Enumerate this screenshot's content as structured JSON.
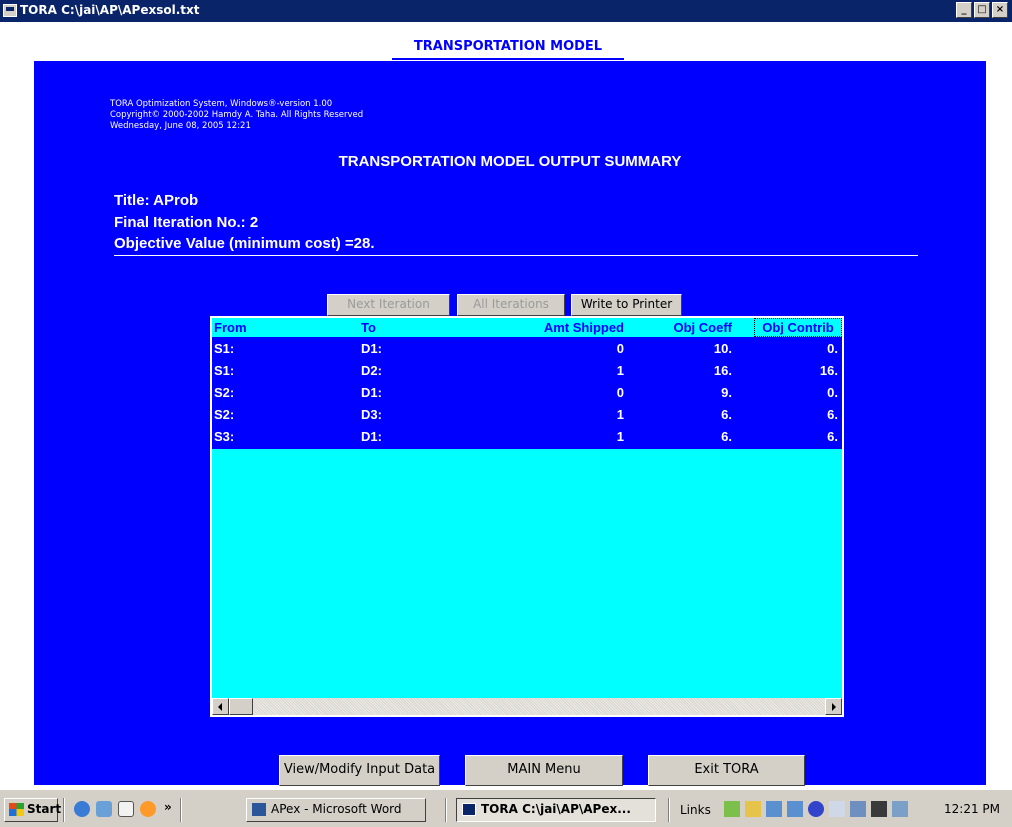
{
  "window": {
    "title": "TORA  C:\\jai\\AP\\APexsol.txt",
    "controls": [
      "_",
      "□",
      "×"
    ]
  },
  "header": {
    "model_title": "TRANSPORTATION MODEL"
  },
  "panel": {
    "copyright_lines": [
      "TORA Optimization System, Windows®-version 1.00",
      "Copyright© 2000-2002 Hamdy A. Taha. All Rights Reserved",
      "Wednesday, June 08, 2005 12:21"
    ],
    "summary_title": "TRANSPORTATION MODEL OUTPUT SUMMARY",
    "title_line": "Title: AProb",
    "iteration_line": "Final Iteration No.: 2",
    "objective_line": "Objective Value (minimum cost) =28."
  },
  "buttons": {
    "next_iteration": "Next Iteration",
    "all_iterations": "All Iterations",
    "write_to_printer": "Write to Printer",
    "view_modify": "View/Modify Input Data",
    "main_menu": "MAIN Menu",
    "exit_tora": "Exit TORA"
  },
  "table": {
    "headers": {
      "from": "From",
      "to": "To",
      "amt_shipped": "Amt Shipped",
      "obj_coeff": "Obj Coeff",
      "obj_contrib": "Obj Contrib"
    },
    "rows": [
      {
        "from": "S1:",
        "to": "D1:",
        "amt": "0",
        "coeff": "10.",
        "contrib": "0."
      },
      {
        "from": "S1:",
        "to": "D2:",
        "amt": "1",
        "coeff": "16.",
        "contrib": "16."
      },
      {
        "from": "S2:",
        "to": "D1:",
        "amt": "0",
        "coeff": "9.",
        "contrib": "0."
      },
      {
        "from": "S2:",
        "to": "D3:",
        "amt": "1",
        "coeff": "6.",
        "contrib": "6."
      },
      {
        "from": "S3:",
        "to": "D1:",
        "amt": "1",
        "coeff": "6.",
        "contrib": "6."
      }
    ]
  },
  "taskbar": {
    "start_label": "Start",
    "quick_launch_more": "»",
    "tasks": [
      {
        "label": "APex - Microsoft Word"
      },
      {
        "label": "TORA  C:\\jai\\AP\\APex..."
      }
    ],
    "links_label": "Links",
    "clock": "12:21 PM"
  },
  "colors": {
    "panel_blue": "#0000ff",
    "grid_cyan": "#00ffff",
    "titlebar_navy": "#0a246a",
    "button_gray": "#d4d0c8"
  }
}
